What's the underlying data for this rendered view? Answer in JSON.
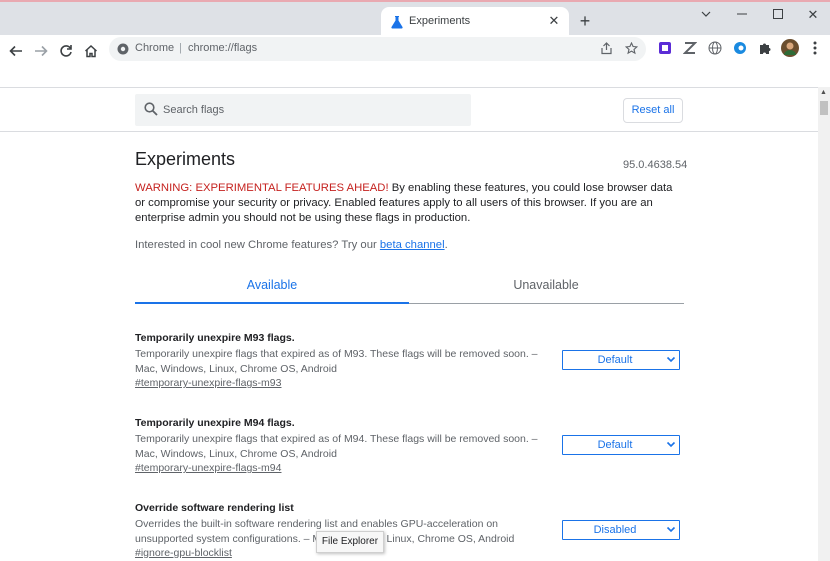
{
  "browser": {
    "tab": {
      "title": "Experiments"
    },
    "address": {
      "site_label": "Chrome",
      "url": "chrome://flags"
    }
  },
  "page": {
    "search": {
      "placeholder": "Search flags"
    },
    "reset_label": "Reset all",
    "title": "Experiments",
    "version": "95.0.4638.54",
    "warning": {
      "red": "WARNING: EXPERIMENTAL FEATURES AHEAD!",
      "text": " By enabling these features, you could lose browser data or compromise your security or privacy. Enabled features apply to all users of this browser. If you are an enterprise admin you should not be using these flags in production."
    },
    "interest": {
      "text": "Interested in cool new Chrome features? Try our ",
      "link": "beta channel",
      "suffix": "."
    },
    "tabs": {
      "available": "Available",
      "unavailable": "Unavailable"
    },
    "flags": [
      {
        "name": "Temporarily unexpire M93 flags.",
        "desc": "Temporarily unexpire flags that expired as of M93. These flags will be removed soon. – Mac, Windows, Linux, Chrome OS, Android",
        "link": "#temporary-unexpire-flags-m93",
        "value": "Default"
      },
      {
        "name": "Temporarily unexpire M94 flags.",
        "desc": "Temporarily unexpire flags that expired as of M94. These flags will be removed soon. – Mac, Windows, Linux, Chrome OS, Android",
        "link": "#temporary-unexpire-flags-m94",
        "value": "Default"
      },
      {
        "name": "Override software rendering list",
        "desc": "Overrides the built-in software rendering list and enables GPU-acceleration on unsupported system configurations. – Mac, Windows, Linux, Chrome OS, Android",
        "link": "#ignore-gpu-blocklist",
        "value": "Disabled"
      }
    ]
  },
  "tooltip": "File Explorer",
  "colors": {
    "accent": "#1a73e8",
    "warning": "#c5221f",
    "tabstrip": "#dee1e6"
  }
}
